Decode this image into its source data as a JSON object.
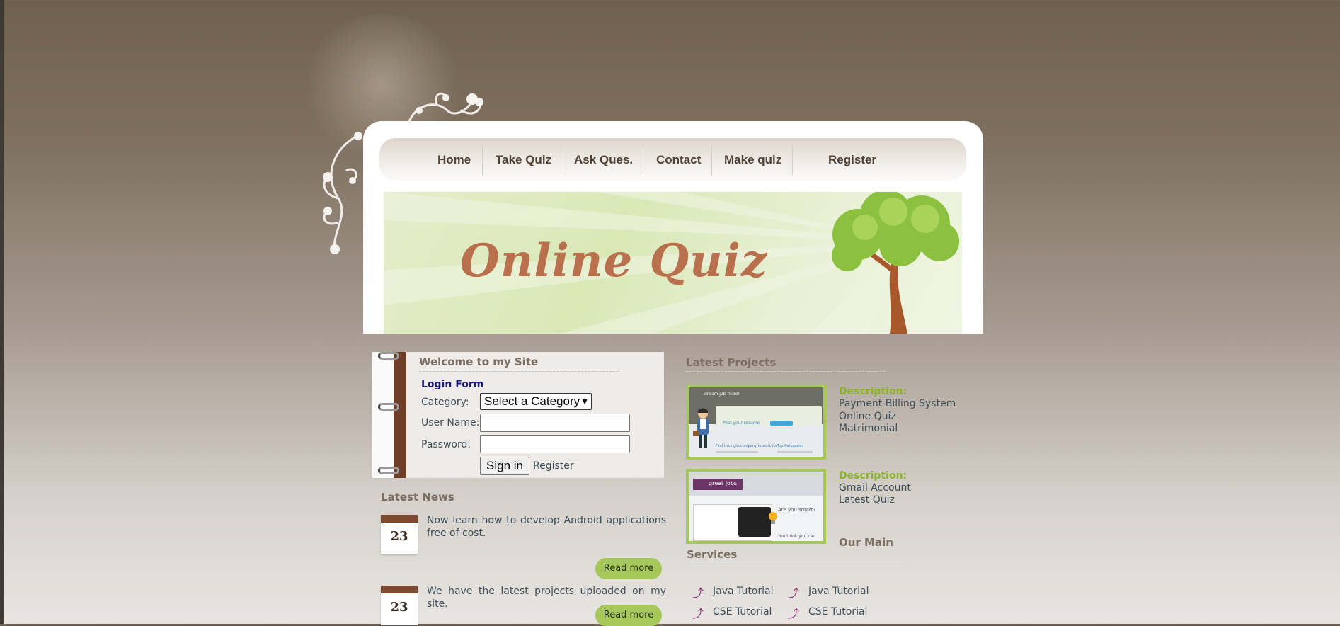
{
  "nav": {
    "items": [
      "Home",
      "Take Quiz",
      "Ask Ques.",
      "Contact",
      "Make quiz",
      "Register"
    ]
  },
  "banner": {
    "title": "Online Quiz"
  },
  "login": {
    "heading": "Welcome to my Site",
    "form_title": "Login Form",
    "category_label": "Category:",
    "category_selected": "Select a Category",
    "username_label": "User Name:",
    "password_label": "Password:",
    "signin_label": "Sign in",
    "register_label": "Register"
  },
  "news": {
    "title": "Latest News",
    "items": [
      {
        "day": "23",
        "text": "Now learn how to develop Android applications free of cost.",
        "read_more": "Read more"
      },
      {
        "day": "23",
        "text": "We have the latest projects uploaded on my site.",
        "read_more": "Read more"
      }
    ]
  },
  "projects": {
    "title": "Latest Projects",
    "items": [
      {
        "label": "Description:",
        "lines": [
          "Payment Billing System",
          "Online Quiz",
          "Matrimonial"
        ]
      },
      {
        "label": "Description:",
        "lines": [
          "Gmail Account",
          "Latest Quiz"
        ]
      }
    ],
    "thumb1": {
      "header": "dream job finder",
      "search_btn": "Post your resume",
      "tab1": "Find the right company to work for",
      "tab2": "Top Categories"
    },
    "thumb2": {
      "brand": "great jobs",
      "heading": "Are you smart?",
      "note": "You think you can"
    }
  },
  "services": {
    "title_part1": "Our Main",
    "title_part2": "Services",
    "items": [
      "Java Tutorial",
      "Java Tutorial",
      "CSE Tutorial",
      "CSE Tutorial"
    ]
  },
  "colors": {
    "accent_green": "#a6c85a",
    "nav_text": "#4f4134",
    "link_blue": "#1c1a79"
  }
}
